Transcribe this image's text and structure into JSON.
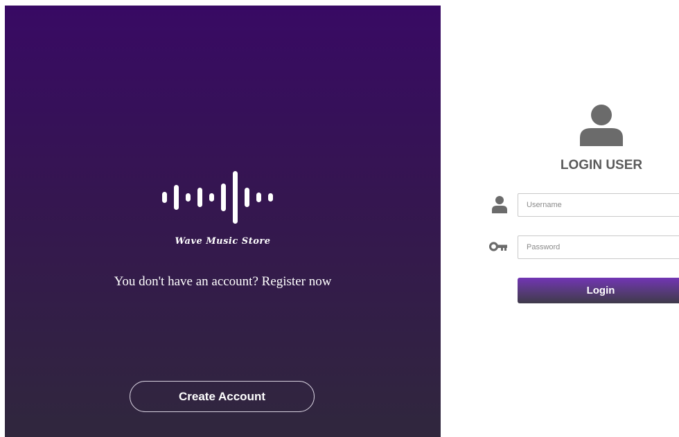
{
  "branding": {
    "store_name": "Wave Music Store",
    "register_prompt": "You don't have an account? Register now",
    "create_account_label": "Create Account",
    "logo_icon": "sound-wave-icon"
  },
  "login": {
    "title": "LOGIN USER",
    "avatar_icon": "user-icon",
    "username_placeholder": "Username",
    "username_value": "",
    "username_icon": "person-icon",
    "password_placeholder": "Password",
    "password_value": "",
    "password_icon": "key-icon",
    "login_label": "Login"
  },
  "colors": {
    "panel_gradient_top": "#380a64",
    "panel_gradient_bottom": "#30273d",
    "button_gradient_top": "#7235b4",
    "button_gradient_bottom": "#3f3a4a",
    "icon_gray": "#6b6b6b",
    "title_gray": "#5a5a5a"
  }
}
